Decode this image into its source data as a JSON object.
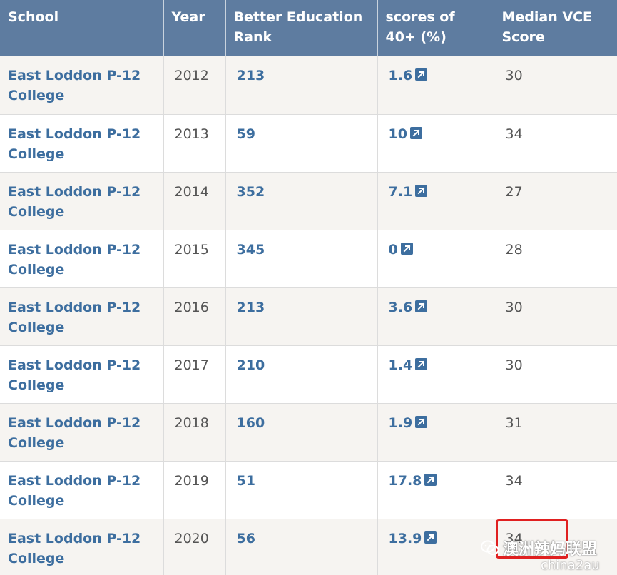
{
  "table": {
    "headers": {
      "school": "School",
      "year": "Year",
      "rank": "Better Education Rank",
      "score": "scores of 40+ (%)",
      "median": "Median VCE Score"
    },
    "rows": [
      {
        "school": "East Loddon P-12 College",
        "year": "2012",
        "rank": "213",
        "score": "1.6",
        "median": "30"
      },
      {
        "school": "East Loddon P-12 College",
        "year": "2013",
        "rank": "59",
        "score": "10",
        "median": "34"
      },
      {
        "school": "East Loddon P-12 College",
        "year": "2014",
        "rank": "352",
        "score": "7.1",
        "median": "27"
      },
      {
        "school": "East Loddon P-12 College",
        "year": "2015",
        "rank": "345",
        "score": "0",
        "median": "28"
      },
      {
        "school": "East Loddon P-12 College",
        "year": "2016",
        "rank": "213",
        "score": "3.6",
        "median": "30"
      },
      {
        "school": "East Loddon P-12 College",
        "year": "2017",
        "rank": "210",
        "score": "1.4",
        "median": "30"
      },
      {
        "school": "East Loddon P-12 College",
        "year": "2018",
        "rank": "160",
        "score": "1.9",
        "median": "31"
      },
      {
        "school": "East Loddon P-12 College",
        "year": "2019",
        "rank": "51",
        "score": "17.8",
        "median": "34"
      },
      {
        "school": "East Loddon P-12 College",
        "year": "2020",
        "rank": "56",
        "score": "13.9",
        "median": "34"
      }
    ]
  },
  "icons": {
    "score_link": "external-link-icon",
    "watermark": "wechat-icon"
  },
  "colors": {
    "header_bg": "#5e7ca0",
    "link": "#3d6e9f",
    "highlight": "#e02020"
  },
  "watermark": {
    "text": "澳洲辣妈联盟",
    "sub": "china2au"
  }
}
